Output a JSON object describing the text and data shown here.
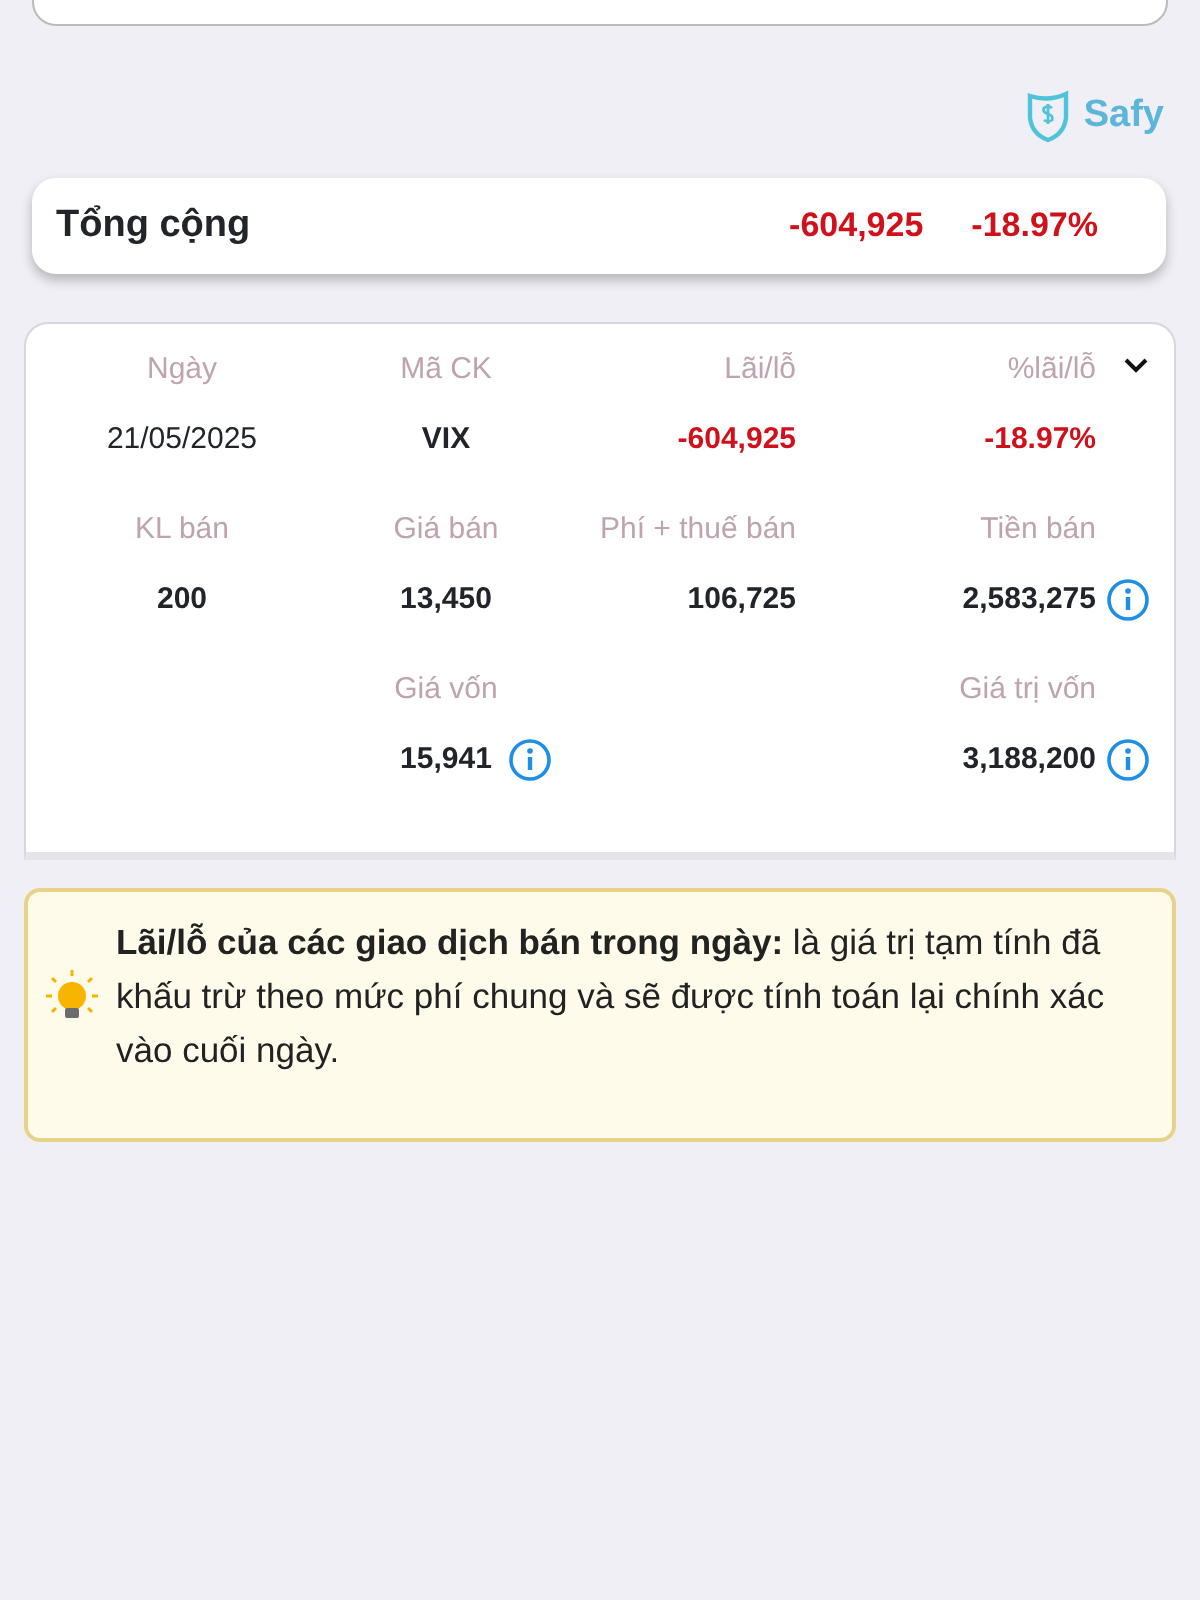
{
  "brand": {
    "name": "Safy"
  },
  "total": {
    "label": "Tổng cộng",
    "amount": "-604,925",
    "percent": "-18.97%",
    "negative": true
  },
  "detail": {
    "expanded": true,
    "rows": [
      [
        {
          "label": "Ngày",
          "value": "21/05/2025",
          "bold": false,
          "negative": false,
          "info": false
        },
        {
          "label": "Mã CK",
          "value": "VIX",
          "bold": true,
          "negative": false,
          "info": false
        },
        {
          "label": "Lãi/lỗ",
          "value": "-604,925",
          "bold": true,
          "negative": true,
          "info": false
        },
        {
          "label": "%lãi/lỗ",
          "value": "-18.97%",
          "bold": true,
          "negative": true,
          "info": false
        }
      ],
      [
        {
          "label": "KL bán",
          "value": "200",
          "bold": true,
          "negative": false,
          "info": false
        },
        {
          "label": "Giá bán",
          "value": "13,450",
          "bold": true,
          "negative": false,
          "info": false
        },
        {
          "label": "Phí + thuế bán",
          "value": "106,725",
          "bold": true,
          "negative": false,
          "info": false
        },
        {
          "label": "Tiền bán",
          "value": "2,583,275",
          "bold": true,
          "negative": false,
          "info": true
        }
      ],
      [
        null,
        {
          "label": "Giá vốn",
          "value": "15,941",
          "bold": true,
          "negative": false,
          "info": true
        },
        null,
        {
          "label": "Giá trị vốn",
          "value": "3,188,200",
          "bold": true,
          "negative": false,
          "info": true
        }
      ]
    ]
  },
  "note": {
    "text": "**Lãi/lỗ của các giao dịch bán trong ngày:** là giá trị tạm tính đã khấu trừ theo mức phí chung và sẽ được tính toán lại chính xác vào cuối ngày."
  }
}
